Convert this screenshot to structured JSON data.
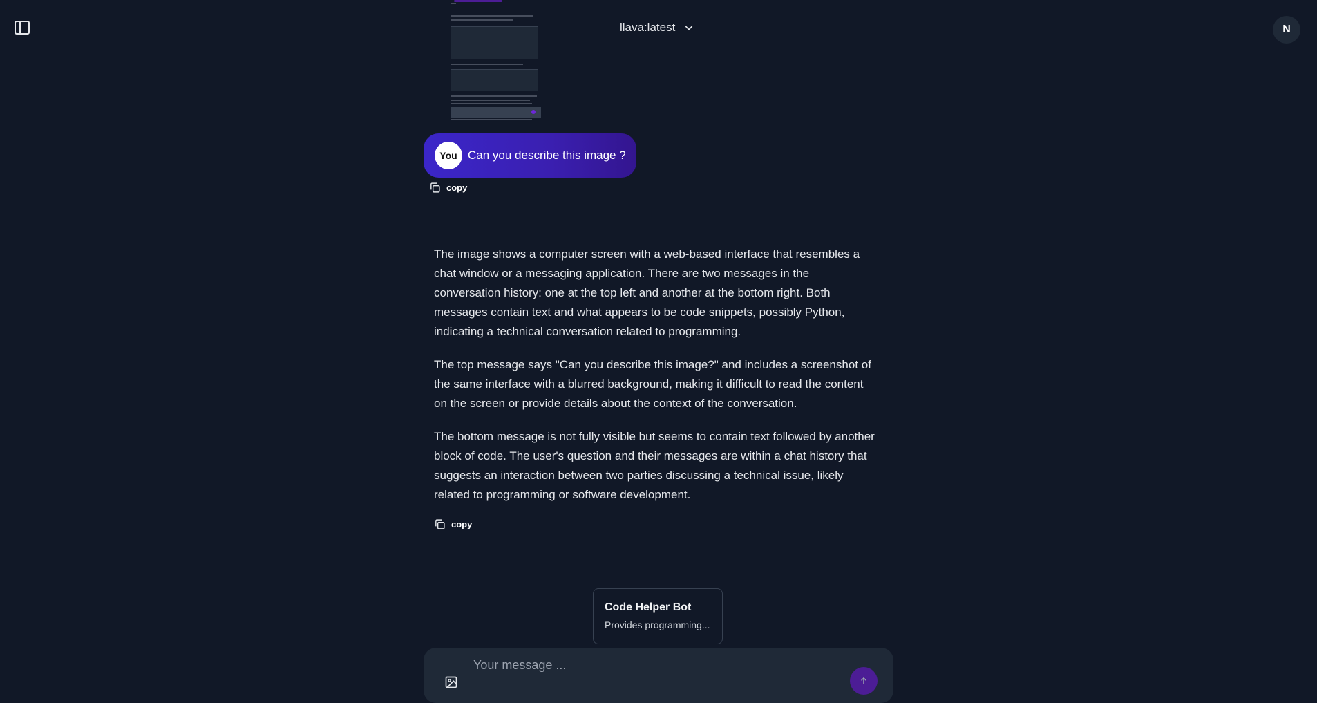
{
  "header": {
    "model_name": "llava:latest",
    "user_initial": "N"
  },
  "conversation": {
    "user_avatar": "You",
    "user_message": "Can you describe this image ?",
    "copy_label": "copy",
    "assistant_paragraphs": [
      "The image shows a computer screen with a web-based interface that resembles a chat window or a messaging application. There are two messages in the conversation history: one at the top left and another at the bottom right. Both messages contain text and what appears to be code snippets, possibly Python, indicating a technical conversation related to programming.",
      "The top message says \"Can you describe this image?\" and includes a screenshot of the same interface with a blurred background, making it difficult to read the content on the screen or provide details about the context of the conversation.",
      "The bottom message is not fully visible but seems to contain text followed by another block of code. The user's question and their messages are within a chat history that suggests an interaction between two parties discussing a technical issue, likely related to programming or software development."
    ]
  },
  "suggestion": {
    "name": "Code Helper Bot",
    "description": "Provides programming..."
  },
  "composer": {
    "placeholder": "Your message ..."
  },
  "icons": {
    "sidebar": "sidebar-toggle-icon",
    "chevron": "chevron-down-icon",
    "copy": "copy-icon",
    "image": "image-upload-icon",
    "send": "arrow-up-icon"
  },
  "colors": {
    "background": "#111827",
    "accent": "#3b26c9",
    "send": "#4c1d95"
  }
}
